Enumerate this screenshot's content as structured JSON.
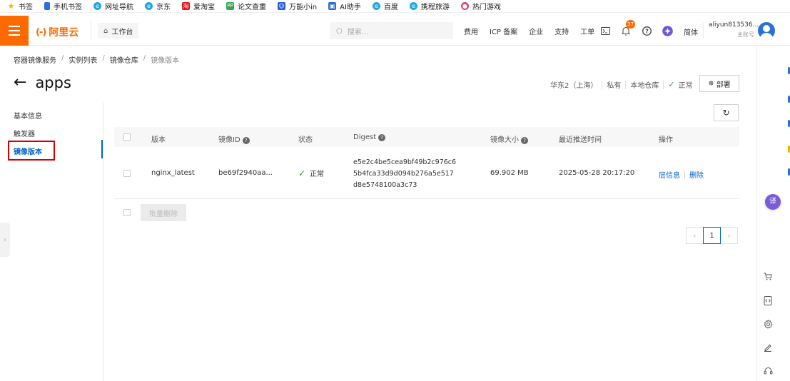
{
  "bookmarks": [
    {
      "label": "书签",
      "icon": "star-icon",
      "color": "#f5b400"
    },
    {
      "label": "手机书签",
      "icon": "bookmark-icon",
      "color": "#2a6fdb"
    },
    {
      "label": "网址导航",
      "icon": "browser-icon",
      "color": "#1fa7e0"
    },
    {
      "label": "京东",
      "icon": "browser-icon",
      "color": "#1fa7e0"
    },
    {
      "label": "爱淘宝",
      "icon": "taobao-icon",
      "color": "#e3141b"
    },
    {
      "label": "论文查重",
      "icon": "pp-icon",
      "color": "#3aa757"
    },
    {
      "label": "万能小in",
      "icon": "assistant-icon",
      "color": "#2a5bd7"
    },
    {
      "label": "AI助手",
      "icon": "ai-icon",
      "color": "#2a6fdb"
    },
    {
      "label": "百度",
      "icon": "browser-icon",
      "color": "#1fa7e0"
    },
    {
      "label": "携程旅游",
      "icon": "browser-icon",
      "color": "#1fa7e0"
    },
    {
      "label": "热门游戏",
      "icon": "game-icon",
      "color": "#e0457b"
    }
  ],
  "topnav": {
    "brand": "阿里云",
    "brand_mark": "(-)",
    "brand_color": "#ff6a00",
    "workbench": "工作台",
    "search_placeholder": "搜索...",
    "links": [
      "费用",
      "ICP 备案",
      "企业",
      "支持",
      "工单"
    ],
    "notification_count": "37",
    "language": "简体",
    "account_name": "aliyun813536...",
    "account_role": "主账号"
  },
  "breadcrumb": [
    "容器镜像服务",
    "实例列表",
    "镜像仓库",
    "镜像版本"
  ],
  "page": {
    "title": "apps",
    "region": "华东2（上海）",
    "visibility": "私有",
    "repo_type": "本地仓库",
    "status": "正常",
    "deploy_label": "部署"
  },
  "left_menu": {
    "items": [
      "基本信息",
      "触发器",
      "镜像版本"
    ],
    "active_index": 2
  },
  "table": {
    "headers": {
      "version": "版本",
      "image_id": "镜像ID",
      "status": "状态",
      "digest": "Digest",
      "size": "镜像大小",
      "pushed_at": "最近推送时间",
      "actions": "操作"
    },
    "rows": [
      {
        "version": "nginx_latest",
        "image_id": "be69f2940aa...",
        "status": "正常",
        "digest_lines": [
          "e5e2c4be5cea9bf49b2c976c6",
          "5b4fca33d9d094b276a5e517",
          "d8e5748100a3c73"
        ],
        "size": "69.902 MB",
        "pushed_at": "2025-05-28 20:17:20",
        "action_info": "层信息",
        "action_delete": "删除"
      }
    ]
  },
  "bulk_delete_label": "批量删除",
  "pagination": {
    "current": "1"
  },
  "colors": {
    "accent": "#0064c8",
    "success": "#2f9e44",
    "highlight": "#d60000"
  }
}
